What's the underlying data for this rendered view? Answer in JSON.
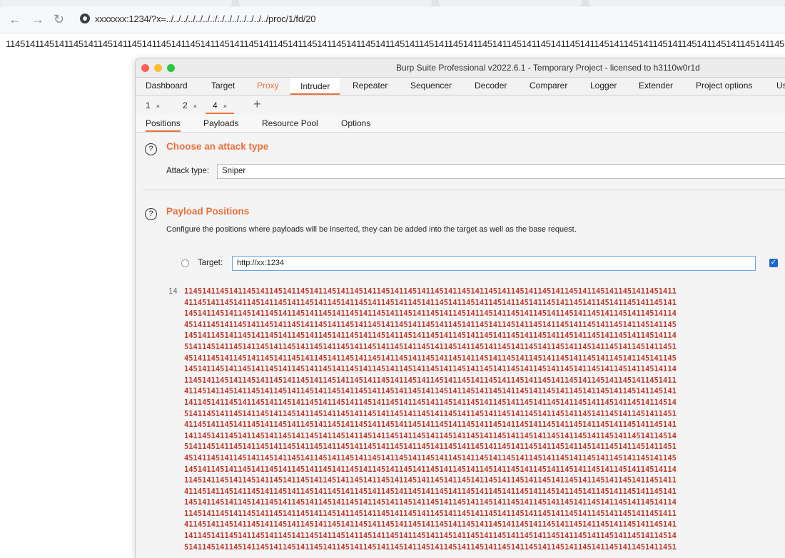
{
  "browser": {
    "url": "xxxxxxx:1234/?x=../../../../../../../../../../../../../../proc/1/fd/20",
    "back_icon": "arrow-left-icon",
    "forward_icon": "arrow-right-icon",
    "reload_icon": "reload-icon"
  },
  "page_banner": "1145141145141145141145141145141145141145141145141145141145141145141145141145141145141145141145141145141145141145141145141145141145141145141145141145141145141145141145141145141145141145141145141",
  "window": {
    "title": "Burp Suite Professional v2022.6.1 - Temporary Project - licensed to h3110w0r1d",
    "main_tabs": [
      "Dashboard",
      "Target",
      "Proxy",
      "Intruder",
      "Repeater",
      "Sequencer",
      "Decoder",
      "Comparer",
      "Logger",
      "Extender",
      "Project options",
      "Us"
    ],
    "attack_tabs": [
      {
        "label": "1",
        "close": "×"
      },
      {
        "label": "2",
        "close": "×"
      },
      {
        "label": "4",
        "close": "×"
      }
    ],
    "add_tab": "+",
    "section_tabs": [
      "Positions",
      "Payloads",
      "Resource Pool",
      "Options"
    ]
  },
  "attack_type": {
    "help": "?",
    "title": "Choose an attack type",
    "label": "Attack type:",
    "value": "Sniper"
  },
  "payload_positions": {
    "help": "?",
    "title": "Payload Positions",
    "description": "Configure the positions where payloads will be inserted, they can be added into the target as well as the base request.",
    "target_label": "Target:",
    "target_value": "http://xx:1234",
    "checkbox_mark": "✓"
  },
  "editor": {
    "line_number": "14",
    "lines": [
      "11451411451411451411451411451411451411451411451411451411451411451411451411451411451411451411451411451411451411",
      "41145141145141145141145141145141145141145141145141145141145141145141145141145141145141145141145141145141145141",
      "14514114514114514114514114514114514114514114514114514114514114514114514114514114514114514114514114514114514114",
      "45141145141145141145141145141145141145141145141145141145141145141145141145141145141145141145141145141145141145",
      "14514114514114514114514114514114514114514114514114514114514114514114514114514114514114514114514114514114514114",
      "51411451411451411451411451411451411451411451411451411451411451411451411451411451411451411451411451411451411451",
      "45141145141145141145141145141145141145141145141145141145141145141145141145141145141145141145141145141145141145",
      "14514114514114514114514114514114514114514114514114514114514114514114514114514114514114514114514114514114514114",
      "11451411451411451411451411451411451411451411451411451411451411451411451411451411451411451411451411451411451411",
      "41145141145141145141145141145141145141145141145141145141145141145141145141145141145141145141145141145141145141",
      "14114514114514114514114514114514114514114514114514114514114514114514114514114514114514114514114514114514114514",
      "51411451411451411451411451411451411451411451411451411451411451411451411451411451411451411451411451411451411451",
      "41145141145141145141145141145141145141145141145141145141145141145141145141145141145141145141145141145141145141",
      "14114514114514114514114514114514114514114514114514114514114514114514114514114514114514114514114514114514114514",
      "51411451411451411451411451411451411451411451411451411451411451411451411451411451411451411451411451411451411451",
      "45141145141145141145141145141145141145141145141145141145141145141145141145141145141145141145141145141145141145",
      "14514114514114514114514114514114514114514114514114514114514114514114514114514114514114514114514114514114514114",
      "11451411451411451411451411451411451411451411451411451411451411451411451411451411451411451411451411451411451411",
      "41145141145141145141145141145141145141145141145141145141145141145141145141145141145141145141145141145141145141",
      "14514114514114514114514114514114514114514114514114514114514114514114514114514114514114514114514114514114514114",
      "11451411451411451411451411451411451411451411451411451411451411451411451411451411451411451411451411451411451411",
      "41145141145141145141145141145141145141145141145141145141145141145141145141145141145141145141145141145141145141",
      "14114514114514114514114514114514114514114514114514114514114514114514114514114514114514114514114514114514114514",
      "51411451411451411451411451411451411451411451411451411451411451411451411451411451411451411451411451411451411451"
    ]
  }
}
